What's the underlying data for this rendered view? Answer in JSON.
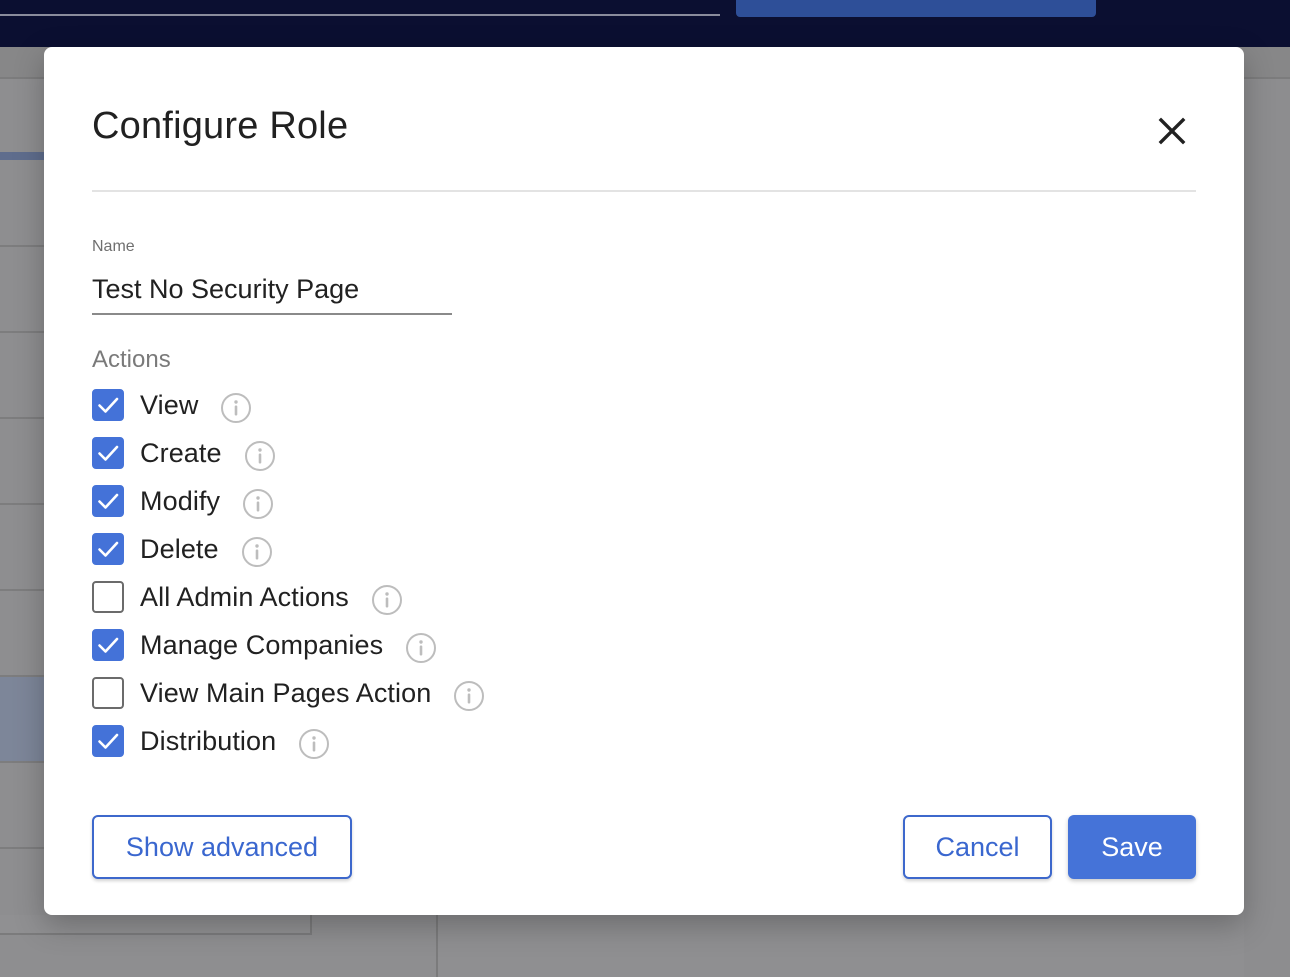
{
  "dialog": {
    "title": "Configure Role",
    "close_icon": "close-icon",
    "name_field": {
      "label": "Name",
      "value": "Test No Security Page"
    },
    "actions_label": "Actions",
    "actions": [
      {
        "label": "View",
        "checked": true,
        "info_icon": "info-icon"
      },
      {
        "label": "Create",
        "checked": true,
        "info_icon": "info-icon"
      },
      {
        "label": "Modify",
        "checked": true,
        "info_icon": "info-icon"
      },
      {
        "label": "Delete",
        "checked": true,
        "info_icon": "info-icon"
      },
      {
        "label": "All Admin Actions",
        "checked": false,
        "info_icon": "info-icon"
      },
      {
        "label": "Manage Companies",
        "checked": true,
        "info_icon": "info-icon"
      },
      {
        "label": "View Main Pages Action",
        "checked": false,
        "info_icon": "info-icon"
      },
      {
        "label": "Distribution",
        "checked": true,
        "info_icon": "info-icon"
      }
    ],
    "buttons": {
      "show_advanced": "Show advanced",
      "cancel": "Cancel",
      "save": "Save"
    }
  },
  "colors": {
    "accent": "#4472d8",
    "overlay_topbar": "#0b0f31",
    "checkbox_unchecked_border": "#6b6b6b",
    "info_icon": "#bdbdbd"
  }
}
